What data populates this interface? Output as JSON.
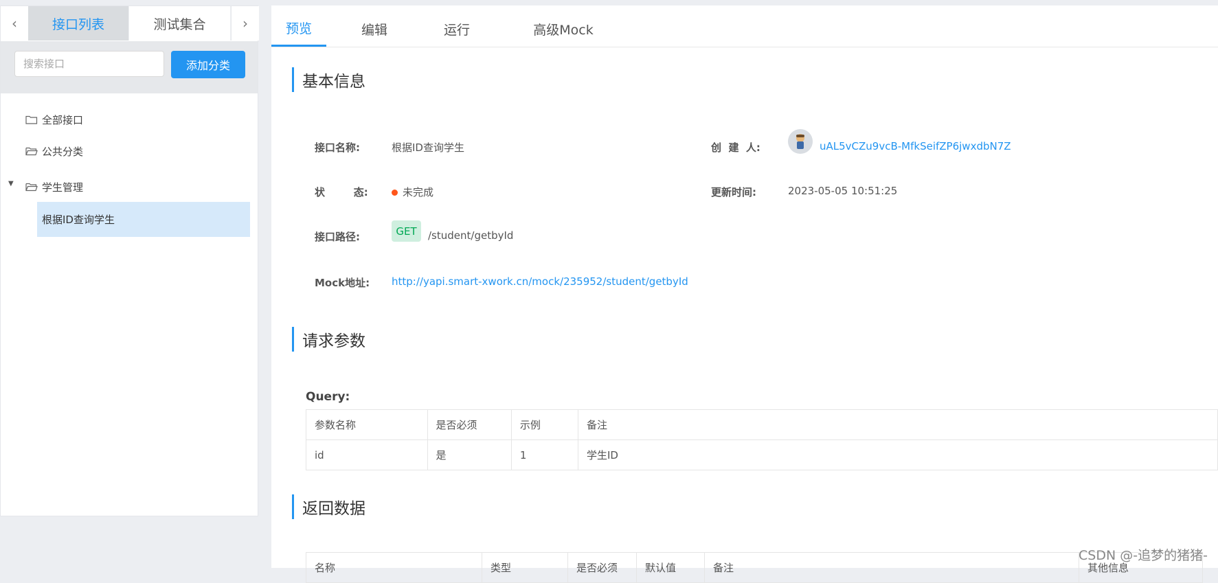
{
  "sidebar": {
    "tabs": {
      "prev_arrow": "‹",
      "next_arrow": "›",
      "active": "接口列表",
      "inactive": "测试集合"
    },
    "search_placeholder": "搜索接口",
    "add_category_label": "添加分类",
    "tree": [
      {
        "label": "全部接口"
      },
      {
        "label": "公共分类"
      },
      {
        "label": "学生管理",
        "expanded": true
      }
    ],
    "selected_leaf": "根据ID查询学生"
  },
  "main": {
    "tabs": [
      "预览",
      "编辑",
      "运行",
      "高级Mock"
    ],
    "basic_info": {
      "title": "基本信息",
      "name_label": "接口名称:",
      "name_value": "根据ID查询学生",
      "creator_label": "创  建  人:",
      "creator_value": "uAL5vCZu9vcB-MfkSeifZP6jwxdbN7Z",
      "status_label": "状        态:",
      "status_value": "未完成",
      "status_color": "#ff561b",
      "updated_label": "更新时间:",
      "updated_value": "2023-05-05 10:51:25",
      "path_label": "接口路径:",
      "method": "GET",
      "path": "/student/getbyId",
      "mock_label": "Mock地址:",
      "mock_url": "http://yapi.smart-xwork.cn/mock/235952/student/getbyId"
    },
    "request": {
      "title": "请求参数",
      "query_label": "Query:",
      "headers": [
        "参数名称",
        "是否必须",
        "示例",
        "备注"
      ],
      "rows": [
        [
          "id",
          "是",
          "1",
          "学生ID"
        ]
      ]
    },
    "response": {
      "title": "返回数据",
      "headers": [
        "名称",
        "类型",
        "是否必须",
        "默认值",
        "备注",
        "其他信息"
      ]
    }
  },
  "watermark": "CSDN @-追梦的猪猪-",
  "colors": {
    "accent": "#2395f1",
    "selected_bg": "#d6e9fa",
    "get_bg": "#cfefdf",
    "get_text": "#00a854"
  }
}
